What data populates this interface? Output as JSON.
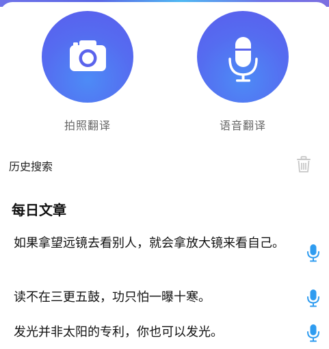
{
  "colors": {
    "accent": "#5a67e6",
    "circle_gradient_top": "#5a5ded",
    "circle_gradient_bottom": "#4d8bf6",
    "mic_blue": "#2f9cf0",
    "trash_gray": "#c8c8c8"
  },
  "actions": [
    {
      "label": "拍照翻译",
      "icon": "camera-icon"
    },
    {
      "label": "语音翻译",
      "icon": "microphone-icon"
    }
  ],
  "history": {
    "title": "历史搜索",
    "icon": "trash-icon"
  },
  "daily": {
    "title": "每日文章",
    "items": [
      {
        "text": "如果拿望远镜去看别人，就会拿放大镜来看自己。",
        "icon": "microphone-icon"
      },
      {
        "text": "读不在三更五鼓，功只怕一曝十寒。",
        "icon": "microphone-icon"
      },
      {
        "text": "发光并非太阳的专利，你也可以发光。",
        "icon": "microphone-icon"
      }
    ]
  }
}
